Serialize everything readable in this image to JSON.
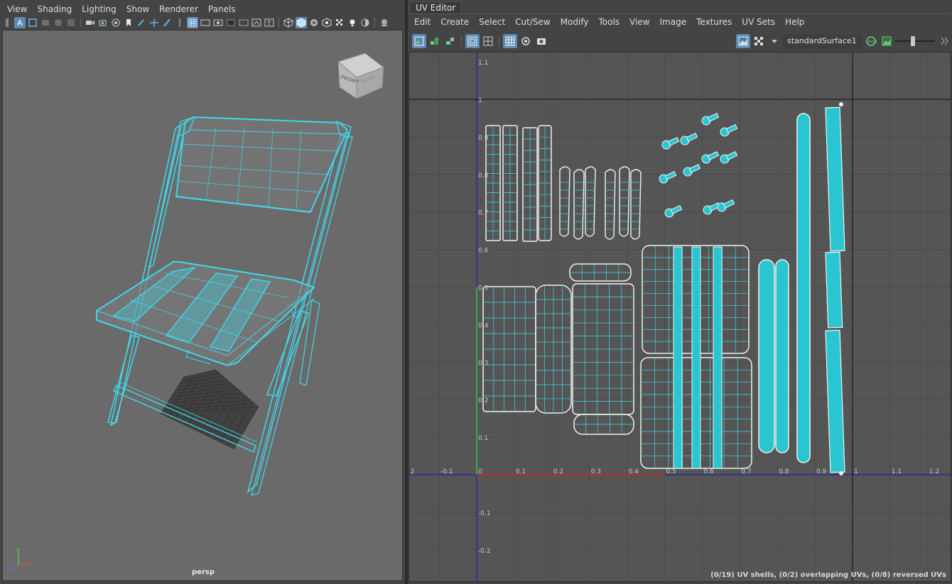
{
  "left_menu": [
    "View",
    "Shading",
    "Lighting",
    "Show",
    "Renderer",
    "Panels"
  ],
  "left_toolbar_icons": [
    "select-camera-icon",
    "camera-attributes-icon",
    "bookmark-icon",
    "image-plane-icon",
    "2d-pan-zoom-icon",
    "grease-pencil-icon",
    "grid-icon",
    "film-gate-icon",
    "resolution-gate-icon",
    "gate-mask-icon",
    "field-chart-icon",
    "safe-action-icon",
    "safe-title-icon",
    "wireframe-icon",
    "smooth-shade-icon",
    "default-material-icon",
    "textured-icon",
    "lights-icon",
    "shadows-icon",
    "isolate-select-icon",
    "xray-icon"
  ],
  "viewcube": {
    "front": "FRONT",
    "right": "RIGHT",
    "top": "TOP"
  },
  "camera_label": "persp",
  "uv_editor": {
    "title": "UV Editor",
    "menu": [
      "Edit",
      "Create",
      "Select",
      "Cut/Sew",
      "Modify",
      "Tools",
      "View",
      "Image",
      "Textures",
      "UV Sets",
      "Help"
    ],
    "shader_name": "standardSurface1",
    "status": "(0/19) UV shells, (0/2) overlapping UVs, (0/8) reversed UVs",
    "axis_x_labels": [
      "2",
      "-0.1",
      "0",
      "0.1",
      "0.2",
      "0.3",
      "0.4",
      "0.5",
      "0.6",
      "0.7",
      "0.8",
      "0.9",
      "1",
      "1.1",
      "1.2"
    ],
    "axis_y_labels": [
      "1.1",
      "1",
      "0.9",
      "0.8",
      "0.7",
      "0.6",
      "0.5",
      "0.4",
      "0.3",
      "0.2",
      "0.1",
      "-0.1",
      "-0.2"
    ]
  },
  "colors": {
    "wire": "#3fd8ec",
    "shell_fill": "#29c6d2",
    "shell_edge": "#f2f2f2",
    "viewport_bg": "#6a6a6a",
    "uv_bg": "#555555",
    "u_axis": "#c02a2a",
    "v_axis": "#2ab04a",
    "grid_axis": "#1f1fb0"
  }
}
